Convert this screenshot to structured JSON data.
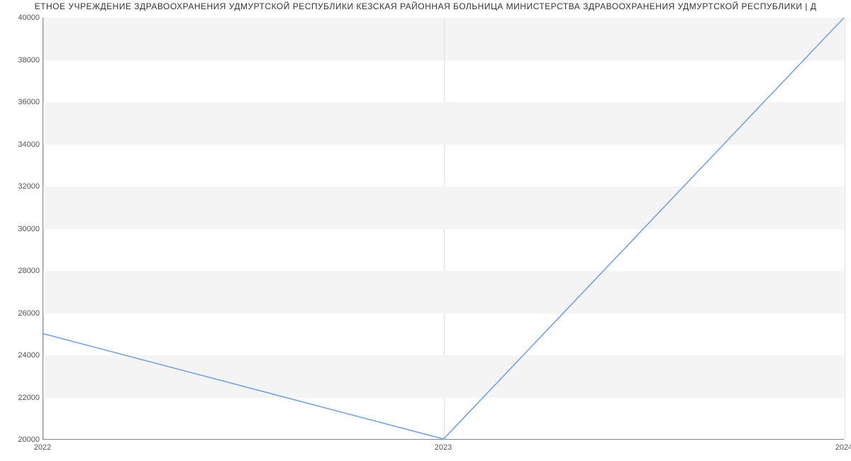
{
  "chart_data": {
    "type": "line",
    "title": "ЕТНОЕ УЧРЕЖДЕНИЕ ЗДРАВООХРАНЕНИЯ УДМУРТСКОЙ РЕСПУБЛИКИ КЕЗСКАЯ РАЙОННАЯ БОЛЬНИЦА МИНИСТЕРСТВА ЗДРАВООХРАНЕНИЯ УДМУРТСКОЙ РЕСПУБЛИКИ | Д",
    "xlabel": "",
    "ylabel": "",
    "x": [
      2022,
      2023,
      2024
    ],
    "values": [
      25000,
      20000,
      40000
    ],
    "x_ticks": [
      2022,
      2023,
      2024
    ],
    "y_ticks": [
      20000,
      22000,
      24000,
      26000,
      28000,
      30000,
      32000,
      34000,
      36000,
      38000,
      40000
    ],
    "xlim": [
      2022,
      2024
    ],
    "ylim": [
      20000,
      40000
    ],
    "line_color": "#6d9ee8"
  }
}
